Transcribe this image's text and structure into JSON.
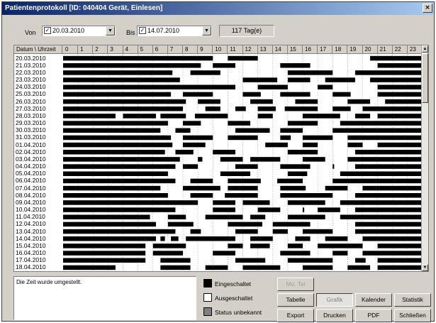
{
  "window": {
    "title": "Patientenprotokoll [ID: 040404 Gerät, Einlesen]",
    "close_label": "×"
  },
  "range": {
    "from_label": "Von",
    "from_date": "20.03.2010",
    "to_label": "Bis",
    "to_date": "14.07.2010",
    "days": "117 Tag(e)"
  },
  "grid": {
    "header_label": "Datum \\ Uhrzeit",
    "hours": [
      "0",
      "1",
      "2",
      "3",
      "4",
      "5",
      "6",
      "7",
      "8",
      "9",
      "10",
      "11",
      "12",
      "13",
      "14",
      "15",
      "16",
      "17",
      "18",
      "19",
      "20",
      "21",
      "22",
      "23"
    ],
    "dates": [
      "20.03.2010",
      "21.03.2010",
      "22.03.2010",
      "23.03.2010",
      "24.03.2010",
      "25.03.2010",
      "26.03.2010",
      "27.03.2010",
      "28.03.2010",
      "29.03.2010",
      "30.03.2010",
      "31.03.2010",
      "01.04.2010",
      "02.04.2010",
      "03.04.2010",
      "04.04.2010",
      "05.04.2010",
      "06.04.2010",
      "07.04.2010",
      "08.04.2010",
      "09.04.2010",
      "10.04.2010",
      "11.04.2010",
      "12.04.2010",
      "13.04.2010",
      "14.04.2010",
      "15.04.2010",
      "16.04.2010",
      "17.04.2010",
      "18.04.2010"
    ],
    "on_intervals": [
      [
        [
          0,
          10
        ],
        [
          11,
          13
        ],
        [
          20.5,
          24
        ]
      ],
      [
        [
          0,
          9.2
        ],
        [
          10,
          11.5
        ],
        [
          14.5,
          16.5
        ],
        [
          21,
          24
        ]
      ],
      [
        [
          0,
          7.3
        ],
        [
          8.5,
          10.5
        ],
        [
          15,
          18
        ],
        [
          19.5,
          24
        ]
      ],
      [
        [
          0,
          7.8
        ],
        [
          12,
          14.3
        ],
        [
          15,
          16.5
        ],
        [
          17.5,
          19.5
        ],
        [
          20.5,
          24
        ]
      ],
      [
        [
          0,
          11.5
        ],
        [
          13,
          15
        ],
        [
          17,
          18
        ],
        [
          21,
          24
        ]
      ],
      [
        [
          0,
          7.2
        ],
        [
          8,
          10
        ],
        [
          12,
          13.2
        ],
        [
          14.5,
          16.5
        ],
        [
          18,
          19.2
        ],
        [
          21,
          24
        ]
      ],
      [
        [
          0,
          8.2
        ],
        [
          9,
          10.5
        ],
        [
          12.5,
          14
        ],
        [
          15.5,
          17
        ],
        [
          19,
          20.5
        ],
        [
          21.5,
          24
        ]
      ],
      [
        [
          0,
          8
        ],
        [
          9.5,
          10.5
        ],
        [
          11.5,
          12.2
        ],
        [
          13,
          14.2
        ],
        [
          14.8,
          17
        ],
        [
          18,
          19.2
        ],
        [
          20,
          24
        ]
      ],
      [
        [
          0,
          3.5
        ],
        [
          4,
          6.2
        ],
        [
          6.5,
          8.2
        ],
        [
          8.8,
          11
        ],
        [
          13,
          14
        ],
        [
          16,
          18.5
        ],
        [
          19.5,
          20.5
        ],
        [
          21,
          24
        ]
      ],
      [
        [
          0,
          7
        ],
        [
          8,
          9.2
        ],
        [
          11,
          12.5
        ],
        [
          15,
          17
        ],
        [
          18.5,
          24
        ]
      ],
      [
        [
          0,
          6.5
        ],
        [
          7.5,
          8.5
        ],
        [
          11.5,
          13.8
        ],
        [
          14.5,
          16
        ],
        [
          18,
          24
        ]
      ],
      [
        [
          0,
          7.2
        ],
        [
          8,
          10
        ],
        [
          11,
          13
        ],
        [
          14.5,
          15.2
        ],
        [
          16,
          18
        ],
        [
          19,
          24
        ]
      ],
      [
        [
          0,
          7.3
        ],
        [
          8,
          9.5
        ],
        [
          13.5,
          15
        ],
        [
          16,
          17
        ],
        [
          19,
          20
        ],
        [
          21,
          24
        ]
      ],
      [
        [
          0,
          6.8
        ],
        [
          7.5,
          8.7
        ],
        [
          10,
          11.5
        ],
        [
          15,
          17
        ],
        [
          19.5,
          24
        ]
      ],
      [
        [
          0,
          7.8
        ],
        [
          9,
          9.3
        ],
        [
          10.5,
          12
        ],
        [
          12.5,
          14.5
        ],
        [
          16,
          17.5
        ],
        [
          19,
          24
        ]
      ],
      [
        [
          0,
          7.5
        ],
        [
          8,
          9
        ],
        [
          11.5,
          13
        ],
        [
          14.5,
          16.5
        ],
        [
          18,
          18.1
        ],
        [
          19.5,
          24
        ]
      ],
      [
        [
          0,
          7
        ],
        [
          10.5,
          12.5
        ],
        [
          15,
          16.3
        ],
        [
          18.5,
          24
        ]
      ],
      [
        [
          0,
          7.5
        ],
        [
          8.5,
          10
        ],
        [
          11,
          13.2
        ],
        [
          14.3,
          16
        ],
        [
          18,
          24
        ]
      ],
      [
        [
          0,
          6.5
        ],
        [
          8,
          10.5
        ],
        [
          11,
          13
        ],
        [
          14.5,
          16.2
        ],
        [
          17.5,
          19
        ],
        [
          20,
          24
        ]
      ],
      [
        [
          0,
          7
        ],
        [
          8.5,
          10
        ],
        [
          10.8,
          13
        ],
        [
          14.5,
          18
        ],
        [
          19.5,
          24
        ]
      ],
      [
        [
          0,
          9
        ],
        [
          10,
          11.5
        ],
        [
          12,
          13.8
        ],
        [
          15,
          17.5
        ],
        [
          18.5,
          24
        ]
      ],
      [
        [
          0,
          7.5
        ],
        [
          10,
          11.5
        ],
        [
          13,
          14.5
        ],
        [
          16,
          16.1
        ],
        [
          17,
          18.5
        ],
        [
          19.5,
          24
        ]
      ],
      [
        [
          0,
          5.8
        ],
        [
          7,
          8.2
        ],
        [
          9.5,
          12
        ],
        [
          12.5,
          13.5
        ],
        [
          15,
          17.5
        ],
        [
          18.5,
          24
        ]
      ],
      [
        [
          0,
          6.2
        ],
        [
          7,
          8.7
        ],
        [
          11,
          13.3
        ],
        [
          14,
          16.5
        ],
        [
          19.5,
          24
        ]
      ],
      [
        [
          0,
          7.5
        ],
        [
          8.5,
          9.2
        ],
        [
          11.5,
          13
        ],
        [
          14,
          15
        ],
        [
          16,
          18
        ],
        [
          19.5,
          24
        ]
      ],
      [
        [
          0,
          6.2
        ],
        [
          6.5,
          6.8
        ],
        [
          7.2,
          7.7
        ],
        [
          8.2,
          11.5
        ],
        [
          12.5,
          14
        ],
        [
          15.5,
          16.5
        ],
        [
          17.5,
          19
        ],
        [
          20,
          24
        ]
      ],
      [
        [
          0,
          5.5
        ],
        [
          6,
          8.2
        ],
        [
          11,
          12
        ],
        [
          12.5,
          13.8
        ],
        [
          15,
          16
        ],
        [
          17,
          20
        ],
        [
          21,
          24
        ]
      ],
      [
        [
          0,
          5.5
        ],
        [
          6,
          8
        ],
        [
          10,
          11.5
        ],
        [
          14.5,
          16.5
        ],
        [
          18,
          19
        ],
        [
          20,
          24
        ]
      ],
      [
        [
          0,
          5.5
        ],
        [
          6.5,
          8.5
        ],
        [
          11.5,
          13.5
        ],
        [
          15,
          18
        ],
        [
          19.5,
          20.2
        ],
        [
          21,
          24
        ]
      ],
      [
        [
          0,
          3.5
        ],
        [
          6.5,
          8.5
        ],
        [
          9.5,
          11
        ],
        [
          12,
          14.5
        ],
        [
          16,
          18
        ],
        [
          19,
          20.5
        ],
        [
          21,
          24
        ]
      ]
    ]
  },
  "message": "Die Zeit wurde umgestellt.",
  "legend": [
    {
      "label": "Eingeschaltet",
      "color": "#000000"
    },
    {
      "label": "Ausgeschaltet",
      "color": "#ffffff"
    },
    {
      "label": "Status unbekannt",
      "color": "#808080"
    }
  ],
  "buttons": {
    "mo_tel": "Mo. Tel",
    "tabelle": "Tabelle",
    "grafik": "Grafik",
    "kalender": "Kalender",
    "statistik": "Statistik",
    "export": "Export",
    "drucken": "Drucken",
    "pdf": "PDF",
    "schliessen": "Schließen"
  },
  "colors": {
    "on": "#000000",
    "off": "#ffffff",
    "titlebar": "#0a246a"
  }
}
